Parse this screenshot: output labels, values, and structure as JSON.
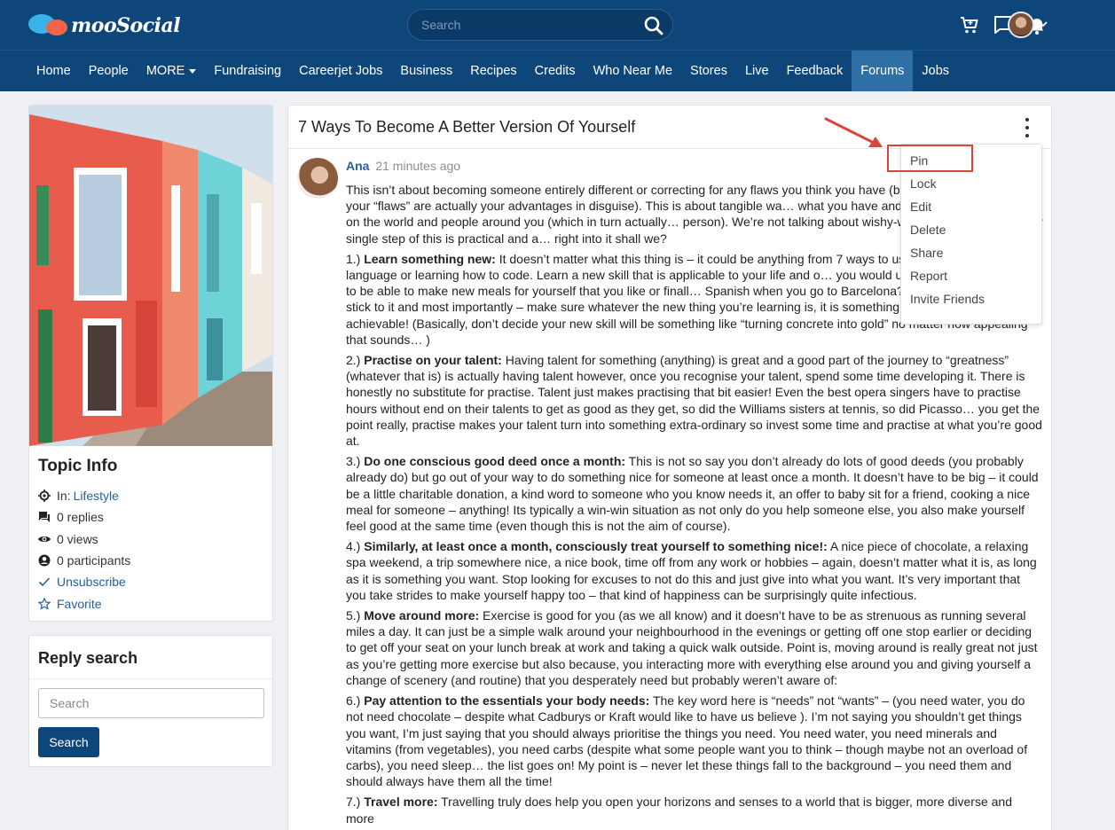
{
  "header": {
    "logo_text": "mooSocial",
    "search_placeholder": "Search"
  },
  "nav": {
    "items": [
      {
        "label": "Home",
        "active": false
      },
      {
        "label": "People",
        "active": false
      },
      {
        "label": "MORE",
        "active": false,
        "has_caret": true
      },
      {
        "label": "Fundraising",
        "active": false
      },
      {
        "label": "Careerjet Jobs",
        "active": false
      },
      {
        "label": "Business",
        "active": false
      },
      {
        "label": "Recipes",
        "active": false
      },
      {
        "label": "Credits",
        "active": false
      },
      {
        "label": "Who Near Me",
        "active": false
      },
      {
        "label": "Stores",
        "active": false
      },
      {
        "label": "Live",
        "active": false
      },
      {
        "label": "Feedback",
        "active": false
      },
      {
        "label": "Forums",
        "active": true
      },
      {
        "label": "Jobs",
        "active": false
      }
    ]
  },
  "topic_info": {
    "title": "Topic Info",
    "in_label": "In:",
    "category": "Lifestyle",
    "replies": "0 replies",
    "views": "0 views",
    "participants": "0 participants",
    "unsubscribe": "Unsubscribe",
    "favorite": "Favorite"
  },
  "reply_search": {
    "title": "Reply search",
    "placeholder": "Search",
    "button": "Search"
  },
  "post": {
    "title": "7 Ways To Become A Better Version Of Yourself",
    "author": "Ana",
    "time": "21 minutes ago",
    "intro": "This isn’t about becoming someone entirely different or correcting for any flaws you think you have (b… things you refer to as your “flaws” are actually your advantages in disguise). This is about tangible wa… what you have and making a larger impact on the world and people around you (which in turn actually… person). We’re not talking about wishy-washy ways either – every single step of this is practical and a… right into it shall we?",
    "points": [
      {
        "num": "1.)",
        "head": "Learn something new:",
        "text": " It doesn’t matter what this thing is – it could be anything from 7 ways to us… learning a new language or learning how to code. Learn a new skill that is applicable to your life and o… you would use – how nice would it be to be able to make new meals for yourself that you like or finall… Spanish when you go to Barcelona? Try to set a plan and stick to it and most importantly – make sure whatever the new thing you’re learning is, it is something that is practical and achievable! (Basically, don’t decide your new skill will be something like “turning concrete into gold” no matter how appealing that sounds… )"
      },
      {
        "num": "2.)",
        "head": "Practise on your talent:",
        "text": " Having talent for something (anything) is great and a good part of the journey to “greatness” (whatever that is) is actually having talent however, once you recognise your talent, spend some time developing it. There is honestly no substitute for practise. Talent just makes practising that bit easier! Even the best opera singers have to practise hours without end on their talents to get as good as they get, so did the Williams sisters at tennis, so did Picasso… you get the point really, practise makes your talent turn into something extra-ordinary so invest some time and practise at what you’re good at."
      },
      {
        "num": "3.)",
        "head": "Do one conscious good deed once a month:",
        "text": " This is not so say you don’t already do lots of good deeds (you probably already do) but go out of your way to do something nice for someone at least once a month. It doesn’t have to be big – it could be a little charitable donation, a kind word to someone who you know needs it, an offer to baby sit for a friend, cooking a nice meal for someone – anything! Its typically a win-win situation as not only do you help someone else, you also make yourself feel good at the same time (even though this is not the aim of course)."
      },
      {
        "num": "4.)",
        "head": "Similarly, at least once a month, consciously treat yourself to something nice!:",
        "text": " A nice piece of chocolate, a relaxing spa weekend, a trip somewhere nice, a nice book, time off from any work or hobbies – again, doesn’t matter what it is, as long as it is something you want. Stop looking for excuses to not do this and just give into what you want. It’s very important that you take strides to make yourself happy too – that kind of happiness can be surprisingly quite infectious."
      },
      {
        "num": "5.)",
        "head": "Move around more:",
        "text": " Exercise is good for you (as we all know) and it doesn’t have to be as strenuous as running several miles a day. It can just be a simple walk around your neighbourhood in the evenings or getting off one stop earlier or deciding to get off your seat on your lunch break at work and taking a quick walk outside. Point is, moving around is really great not just as you’re getting more exercise but also because, you interacting more with everything else around you and giving yourself a change of scenery (and routine) that you desperately need but probably weren’t aware of:"
      },
      {
        "num": "6.)",
        "head": "Pay attention to the essentials your body needs:",
        "text": " The key word here is “needs” not “wants” – (you need water, you do not need chocolate – despite what Cadburys or Kraft would like to have us believe  ). I’m not saying you shouldn’t get things you want, I’m just saying that you should always prioritise the things you need. You need water, you need minerals and vitamins (from vegetables), you need carbs (despite what some people want you to think – though maybe not an overload of carbs), you need sleep… the list goes on! My point is – never let these things fall to the background – you need them and should always have them all the time!"
      },
      {
        "num": "7.)",
        "head": "Travel more:",
        "text": " Travelling truly does help you open your horizons and senses to a world that is bigger, more diverse and more"
      }
    ]
  },
  "post_menu": {
    "items": [
      "Pin",
      "Lock",
      "Edit",
      "Delete",
      "Share",
      "Report",
      "Invite Friends"
    ]
  },
  "colors": {
    "header_bg": "#0f467a",
    "nav_active": "#2f6fa6",
    "link": "#2a5f9e",
    "highlight": "#d9453c"
  }
}
